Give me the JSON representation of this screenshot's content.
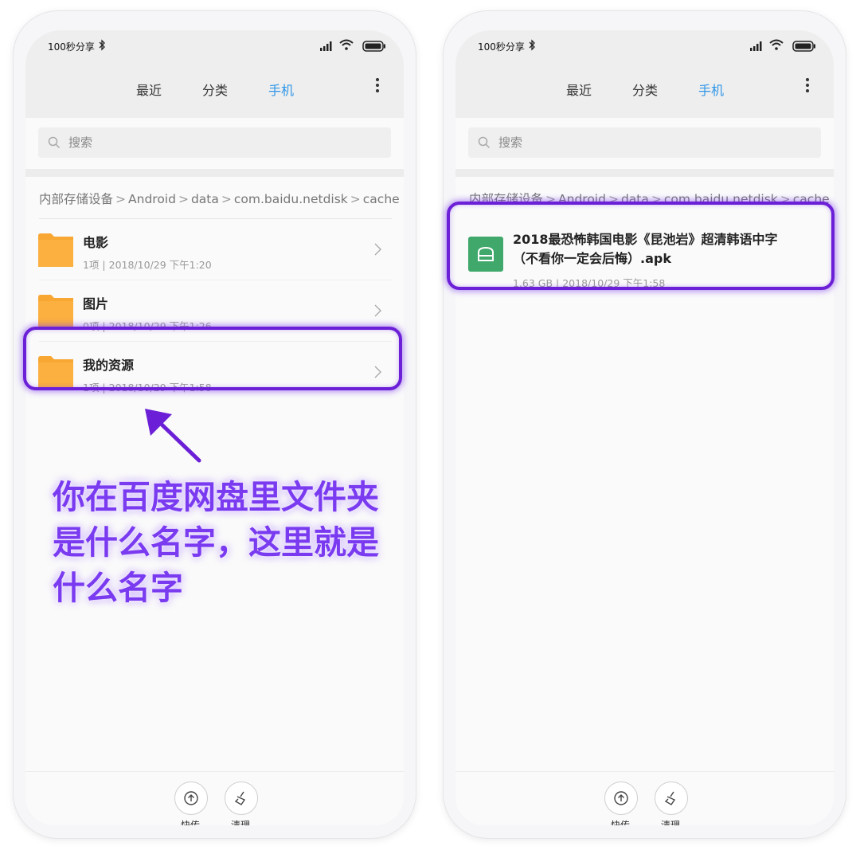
{
  "status": {
    "share_text": "100秒分享"
  },
  "tabs": [
    "最近",
    "分类",
    "手机"
  ],
  "search": {
    "placeholder": "搜索"
  },
  "breadcrumb": [
    "内部存储设备",
    "Android",
    "data",
    "com.baidu.netdisk",
    "cache"
  ],
  "left_list": [
    {
      "name": "电影",
      "meta": "1项 | 2018/10/29 下午1:20"
    },
    {
      "name": "图片",
      "meta": "0项 | 2018/10/29 下午1:26"
    },
    {
      "name": "我的资源",
      "meta": "1项 | 2018/10/29 下午1:58"
    }
  ],
  "right_file": {
    "name_line1": "2018最恐怖韩国电影《昆池岩》超清韩语中字",
    "name_line2": "（不看你一定会后悔）.apk",
    "meta": "1.63 GB | 2018/10/29 下午1:58"
  },
  "bottom": {
    "share_label": "快传",
    "clean_label": "清理"
  },
  "annotation": {
    "line1": "你在百度网盘里文件夹",
    "line2": "是什么名字，这里就是",
    "line3": "什么名字"
  },
  "colors": {
    "accent": "#2f96e8",
    "highlight": "#6b1fd6",
    "folder": "#f7a732",
    "apk": "#3fa86a"
  }
}
